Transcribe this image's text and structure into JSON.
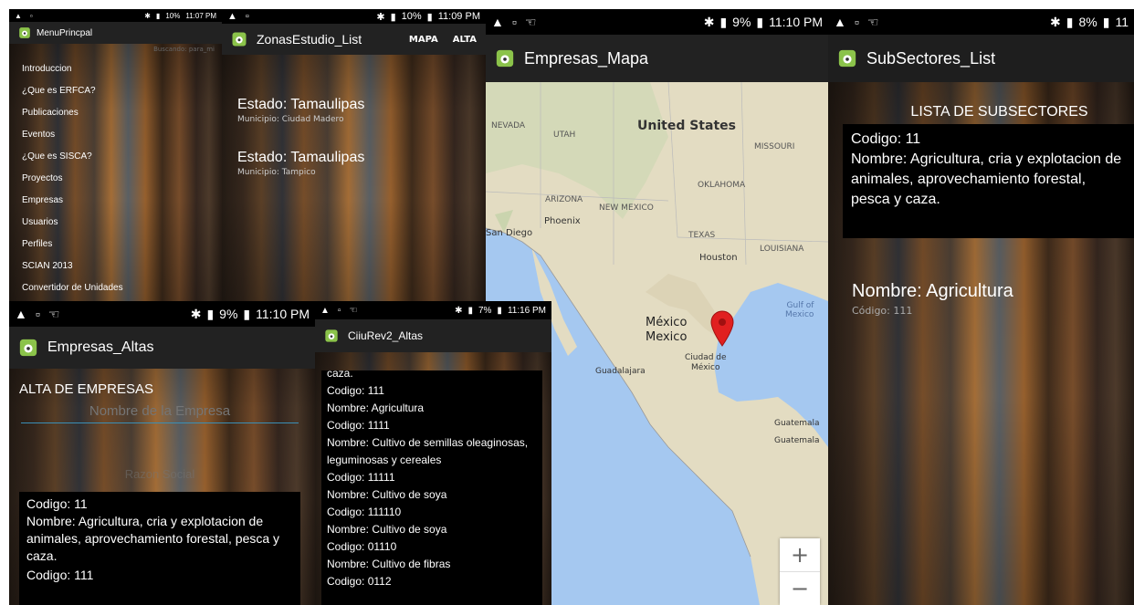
{
  "colors": {
    "actionbar": "#222222",
    "statusbar": "#000000",
    "map_water": "#a5c8f0",
    "map_land": "#e8e0c8",
    "pin": "#e02020",
    "underline": "#3a8fb7"
  },
  "p1": {
    "status": {
      "time": "11:07 PM",
      "battery": "10%"
    },
    "title": "MenuPrincpal",
    "search_hint": "Buscando: para_mi",
    "items": [
      "Introduccion",
      "¿Que es ERFCA?",
      "Publicaciones",
      "Eventos",
      "¿Que es SISCA?",
      "Proyectos",
      "Empresas",
      "Usuarios",
      "Perfiles",
      "SCIAN 2013",
      "Convertidor de Unidades"
    ]
  },
  "p2": {
    "status": {
      "time": "11:09 PM",
      "battery": "10%"
    },
    "title": "ZonasEstudio_List",
    "actions": [
      "MAPA",
      "ALTA"
    ],
    "entries": [
      {
        "estado": "Estado: Tamaulipas",
        "municipio": "Municipio: Ciudad Madero"
      },
      {
        "estado": "Estado: Tamaulipas",
        "municipio": "Municipio: Tampico"
      }
    ]
  },
  "p3": {
    "status": {
      "time": "11:10 PM",
      "battery": "9%"
    },
    "title": "Empresas_Mapa",
    "labels": {
      "nevada": "NEVADA",
      "utah": "UTAH",
      "us": "United States",
      "missouri": "MISSOURI",
      "oklahoma": "OKLAHOMA",
      "arizona": "ARIZONA",
      "newmexico": "NEW MEXICO",
      "phoenix": "Phoenix",
      "sandiego": "San Diego",
      "texas": "TEXAS",
      "louisiana": "LOUISIANA",
      "houston": "Houston",
      "gulf": "Gulf of\nMexico",
      "mexico": "México\nMexico",
      "cdmx": "Ciudad de\nMéxico",
      "guadalajara": "Guadalajara",
      "guatemala1": "Guatemala",
      "guatemala2": "Guatemala"
    },
    "zoom_in": "+",
    "zoom_out": "−"
  },
  "p4": {
    "status": {
      "time": "11",
      "battery": "8%"
    },
    "title": "SubSectores_List",
    "heading": "LISTA DE SUBSECTORES",
    "codigo": "Codigo: 11",
    "nombre": "Nombre: Agricultura, cria y explotacion de animales, aprovechamiento forestal, pesca y caza.",
    "item_nombre": "Nombre: Agricultura",
    "item_codigo": "Código: 111"
  },
  "p5": {
    "status": {
      "time": "11:10 PM",
      "battery": "9%"
    },
    "title": "Empresas_Altas",
    "heading": "ALTA DE EMPRESAS",
    "empresa_placeholder": "Nombre de la Empresa",
    "razon_placeholder": "Razon Social",
    "codigo": "Codigo: 11",
    "nombre": "Nombre: Agricultura, cria y explotacion de animales, aprovechamiento forestal, pesca y caza.",
    "codigo2": "Codigo: 111"
  },
  "p6": {
    "status": {
      "time": "11:16 PM",
      "battery": "7%"
    },
    "title": "CiiuRev2_Altas",
    "lines": [
      "caza.",
      "Codigo: 111",
      "Nombre: Agricultura",
      "Codigo: 1111",
      "Nombre: Cultivo de semillas oleaginosas, leguminosas y cereales",
      "Codigo: 11111",
      "Nombre: Cultivo de soya",
      "Codigo: 111110",
      "Nombre: Cultivo de soya",
      "Codigo: 01110",
      "Nombre: Cultivo de fibras",
      "Codigo: 0112"
    ]
  }
}
